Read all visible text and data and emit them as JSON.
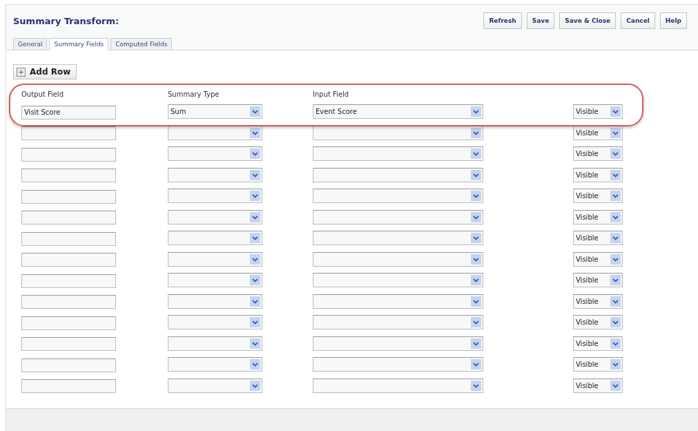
{
  "title": "Summary Transform:",
  "buttons": [
    "Refresh",
    "Save",
    "Save & Close",
    "Cancel",
    "Help"
  ],
  "tabs": [
    {
      "label": "General",
      "selected": false
    },
    {
      "label": "Summary Fields",
      "selected": true
    },
    {
      "label": "Computed Fields",
      "selected": false
    }
  ],
  "add_row": "Add Row",
  "columns": [
    "Output Field",
    "Summary Type",
    "Input Field"
  ],
  "highlight_first_row": true,
  "rows": [
    {
      "output_field": "Visit Score",
      "summary_type": "Sum",
      "input_field": "Event Score",
      "visibility": "Visible"
    },
    {
      "visibility": "Visible"
    },
    {
      "visibility": "Visible"
    },
    {
      "visibility": "Visible"
    },
    {
      "visibility": "Visible"
    },
    {
      "visibility": "Visible"
    },
    {
      "visibility": "Visible"
    },
    {
      "visibility": "Visible"
    },
    {
      "visibility": "Visible"
    },
    {
      "visibility": "Visible"
    },
    {
      "visibility": "Visible"
    },
    {
      "visibility": "Visible"
    },
    {
      "visibility": "Visible"
    },
    {
      "visibility": "Visible"
    }
  ]
}
